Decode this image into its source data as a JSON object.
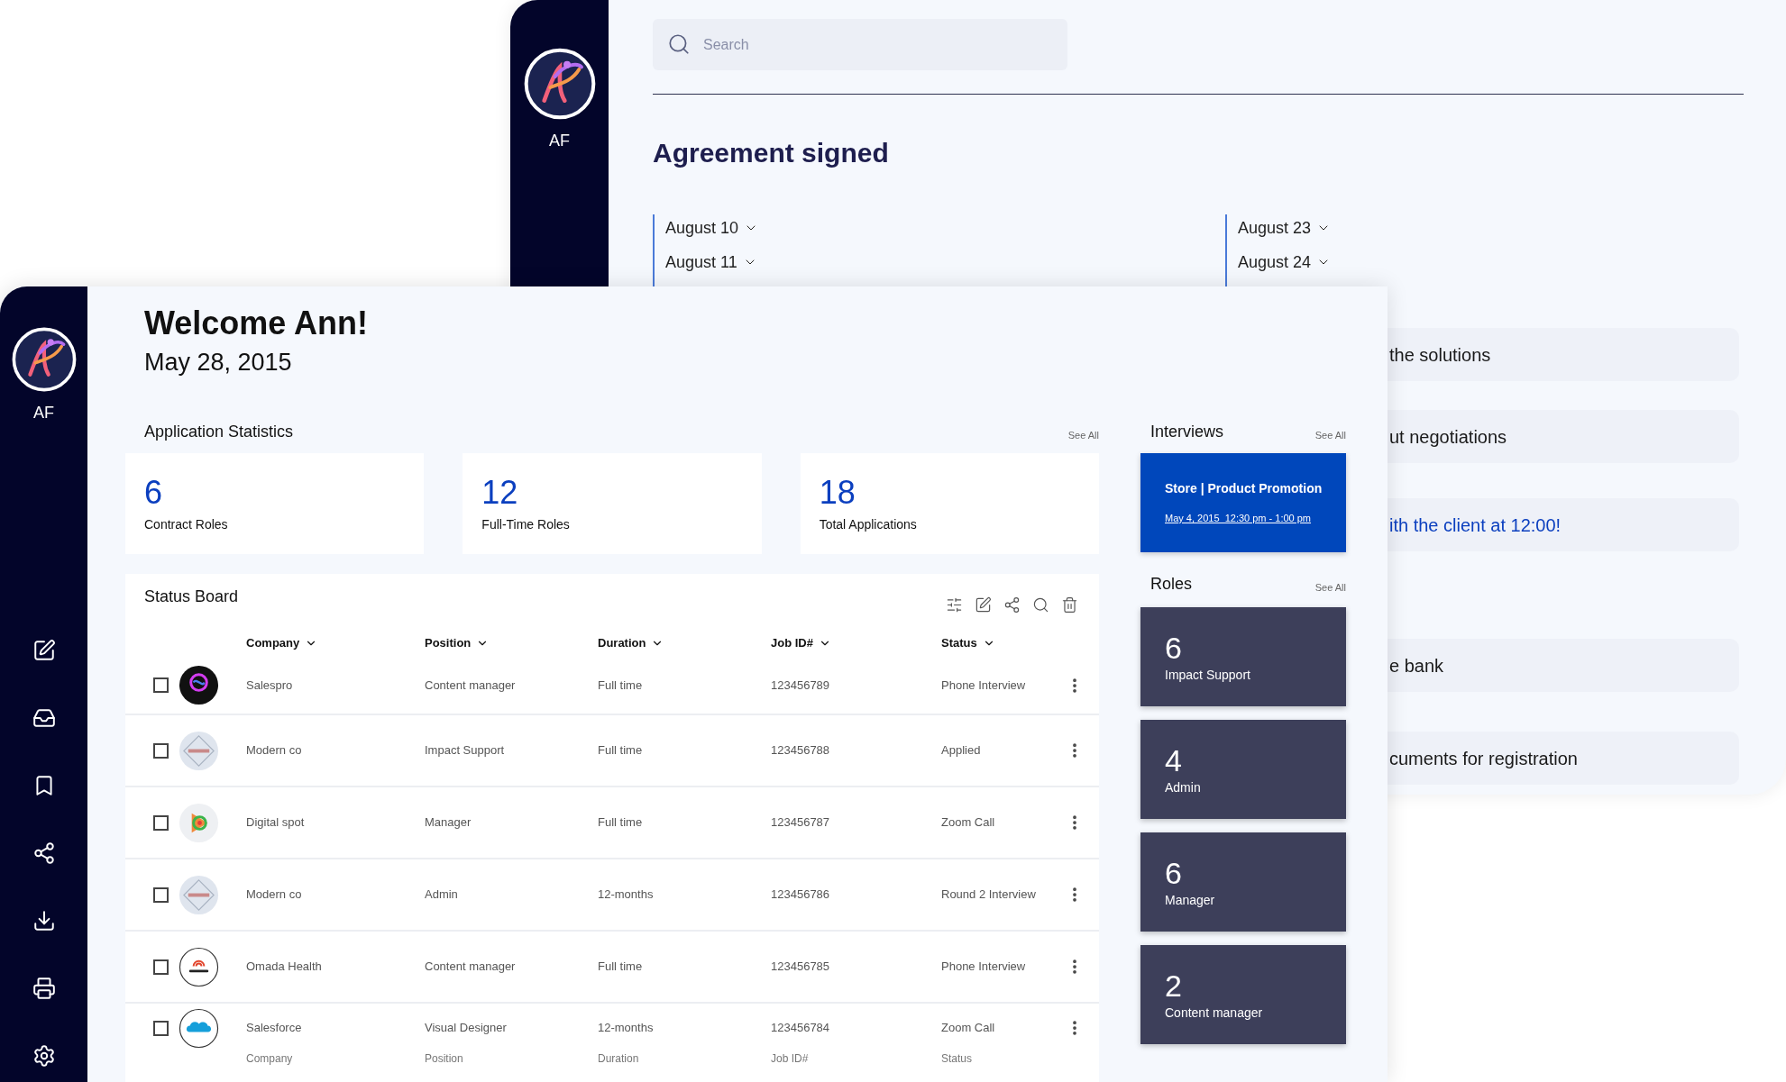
{
  "back_window": {
    "sidebar": {
      "initials": "AF"
    },
    "search": {
      "placeholder": "Search"
    },
    "title": "Agreement signed",
    "date_columns": [
      {
        "dates": [
          "August 10",
          "August 11"
        ]
      },
      {
        "dates": [
          "August 23",
          "August 24"
        ]
      }
    ],
    "tasks": [
      {
        "text": "the solutions",
        "highlighted": false
      },
      {
        "text": "ut negotiations",
        "highlighted": false
      },
      {
        "text": "ith the client at 12:00!",
        "highlighted": true
      },
      {
        "text": "e bank",
        "highlighted": false
      },
      {
        "text": "cuments for registration",
        "highlighted": false
      }
    ]
  },
  "front_window": {
    "sidebar": {
      "initials": "AF"
    },
    "greeting": "Welcome Ann!",
    "date": "May 28, 2015",
    "statistics": {
      "title": "Application Statistics",
      "see_all": "See All",
      "cards": [
        {
          "value": "6",
          "label": "Contract Roles"
        },
        {
          "value": "12",
          "label": "Full-Time Roles"
        },
        {
          "value": "18",
          "label": "Total Applications"
        }
      ]
    },
    "status_board": {
      "title": "Status Board",
      "columns": [
        "Company",
        "Position",
        "Duration",
        "Job ID#",
        "Status"
      ],
      "rows": [
        {
          "kind": "swirl",
          "checked": false,
          "company": "Salespro",
          "position": "Content manager",
          "duration": "Full time",
          "job_id": "123456789",
          "status": "Phone Interview"
        },
        {
          "kind": "diamond",
          "checked": false,
          "company": "Modern co",
          "position": "Impact Support",
          "duration": "Full time",
          "job_id": "123456788",
          "status": "Applied"
        },
        {
          "kind": "ring",
          "checked": false,
          "company": "Digital spot",
          "position": "Manager",
          "duration": "Full time",
          "job_id": "123456787",
          "status": "Zoom Call"
        },
        {
          "kind": "diamond",
          "checked": false,
          "company": "Modern co",
          "position": "Admin",
          "duration": "12-months",
          "job_id": "123456786",
          "status": "Round 2 Interview"
        },
        {
          "kind": "arcs",
          "checked": false,
          "company": "Omada Health",
          "position": "Content manager",
          "duration": "Full time",
          "job_id": "123456785",
          "status": "Phone Interview"
        },
        {
          "kind": "cloud",
          "checked": false,
          "company": "Salesforce",
          "position": "Visual Designer",
          "duration": "12-months",
          "job_id": "123456784",
          "status": "Zoom Call"
        }
      ],
      "footer": [
        "Company",
        "Position",
        "Duration",
        "Job ID#",
        "Status"
      ]
    },
    "interviews": {
      "title": "Interviews",
      "see_all": "See All",
      "items": [
        {
          "title": "Store | Product Promotion",
          "time": "May 4, 2015  12:30 pm - 1:00 pm"
        }
      ]
    },
    "roles": {
      "title": "Roles",
      "see_all": "See All",
      "items": [
        {
          "count": "6",
          "label": "Impact Support"
        },
        {
          "count": "4",
          "label": "Admin"
        },
        {
          "count": "6",
          "label": "Manager"
        },
        {
          "count": "2",
          "label": "Content manager"
        }
      ]
    }
  }
}
